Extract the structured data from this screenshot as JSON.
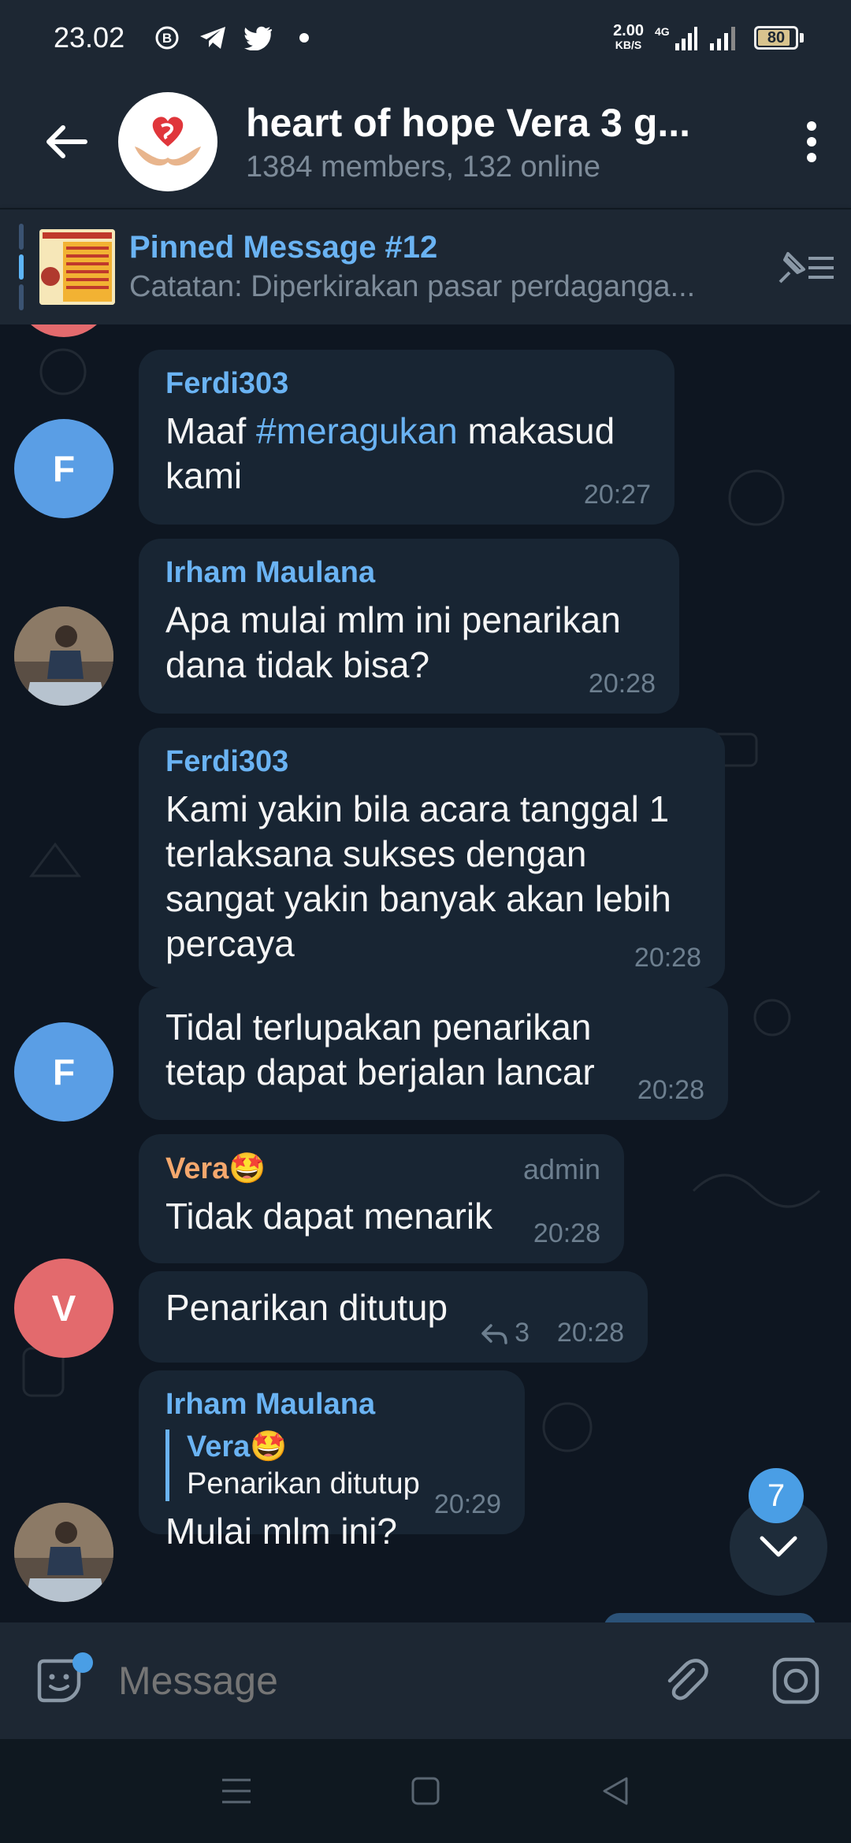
{
  "status_bar": {
    "time": "23.02",
    "net_speed_value": "2.00",
    "net_speed_unit": "KB/S",
    "network": "4G",
    "battery": "80"
  },
  "header": {
    "title": "heart of hope Vera 3 g...",
    "subtitle": "1384 members, 132 online"
  },
  "pinned": {
    "title": "Pinned Message #12",
    "preview": "Catatan: Diperkirakan pasar perdaganga..."
  },
  "messages": [
    {
      "sender": "Ferdi303",
      "text_before": "Maaf ",
      "hashtag": "#meragukan",
      "text_after": " makasud kami",
      "time": "20:27",
      "avatar_letter": "F"
    },
    {
      "sender": "Irham Maulana",
      "text": "Apa mulai mlm ini penarikan dana tidak bisa?",
      "time": "20:28"
    },
    {
      "sender": "Ferdi303",
      "text": "Kami yakin bila acara tanggal 1 terlaksana sukses dengan sangat yakin banyak akan lebih percaya",
      "time": "20:28"
    },
    {
      "text": "Tidal terlupakan penarikan tetap dapat berjalan lancar",
      "time": "20:28",
      "avatar_letter": "F"
    },
    {
      "sender": "Vera🤩",
      "role": "admin",
      "text": "Tidak dapat menarik",
      "time": "20:28"
    },
    {
      "text": "Penarikan ditutup",
      "replies": "3",
      "time": "20:28",
      "avatar_letter": "V"
    },
    {
      "sender": "Irham Maulana",
      "quote_name": "Vera🤩",
      "quote_text": "Penarikan ditutup",
      "text": "Mulai mlm ini?",
      "time": "20:29"
    }
  ],
  "scroll_down_badge": "7",
  "input": {
    "placeholder": "Message"
  },
  "icons": {
    "back": "back-arrow-icon",
    "menu": "more-vertical-icon",
    "pin_list": "pinned-list-icon",
    "sticker": "sticker-emoji-icon",
    "attach": "paperclip-icon",
    "camera": "camera-icon"
  },
  "colors": {
    "background": "#0e1621",
    "header": "#1d2733",
    "bubble": "#182533",
    "accent": "#6ab3f3",
    "admin_name": "#f5a86d"
  }
}
